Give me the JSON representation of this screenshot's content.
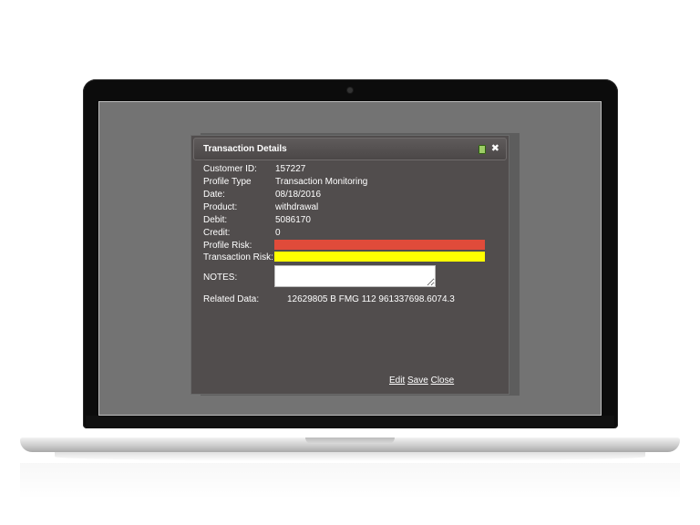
{
  "dialog": {
    "title": "Transaction Details",
    "fields": [
      {
        "label": "Customer ID:",
        "value": "157227"
      },
      {
        "label": "Profile Type",
        "value": "Transaction Monitoring"
      },
      {
        "label": "Date:",
        "value": "08/18/2016"
      },
      {
        "label": "Product:",
        "value": "withdrawal"
      },
      {
        "label": "Debit:",
        "value": "5086170"
      },
      {
        "label": "Credit:",
        "value": "0"
      }
    ],
    "profile_risk": {
      "label": "Profile Risk:",
      "color": "#e04b3a"
    },
    "transaction_risk": {
      "label": "Transaction Risk:",
      "color": "#ffff00"
    },
    "notes": {
      "label": "NOTES:",
      "value": ""
    },
    "related": {
      "label": "Related Data:",
      "value": "12629805 B FMG 112 961337698.6074.3"
    },
    "actions": {
      "edit": "Edit",
      "save": "Save",
      "close": "Close"
    },
    "icons": {
      "pin": "pin-icon",
      "close": "close-icon"
    }
  }
}
